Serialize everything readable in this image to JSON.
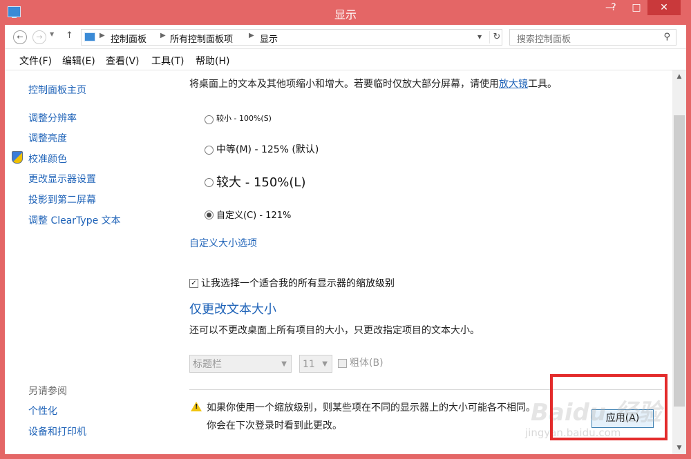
{
  "window": {
    "title": "显示"
  },
  "addressbar": {
    "breadcrumbs": [
      "控制面板",
      "所有控制面板项",
      "显示"
    ],
    "search_placeholder": "搜索控制面板"
  },
  "menubar": {
    "items": [
      "文件(F)",
      "编辑(E)",
      "查看(V)",
      "工具(T)",
      "帮助(H)"
    ]
  },
  "leftnav": {
    "home": "控制面板主页",
    "items": [
      "调整分辨率",
      "调整亮度",
      "校准颜色",
      "更改显示器设置",
      "投影到第二屏幕",
      "调整 ClearType 文本"
    ],
    "see_also_title": "另请参阅",
    "see_also": [
      "个性化",
      "设备和打印机"
    ]
  },
  "content": {
    "intro_before": "将桌面上的文本及其他项缩小和增大。若要临时仅放大部分屏幕，请使用",
    "intro_link": "放大镜",
    "intro_after": "工具。",
    "options": [
      {
        "label": "较小 - 100%(S)",
        "selected": false
      },
      {
        "label": "中等(M) - 125% (默认)",
        "selected": false
      },
      {
        "label": "较大 - 150%(L)",
        "selected": false
      },
      {
        "label": "自定义(C) - 121%",
        "selected": true
      }
    ],
    "custom_link": "自定义大小选项",
    "checkbox_label": "让我选择一个适合我的所有显示器的缩放级别",
    "checkbox_checked": true,
    "section_title": "仅更改文本大小",
    "section_desc": "还可以不更改桌面上所有项目的大小，只更改指定项目的文本大小。",
    "item_select": "标题栏",
    "size_select": "11",
    "bold_label": "粗体(B)",
    "warning_line1": "如果你使用一个缩放级别，则某些项在不同的显示器上的大小可能各不相同。",
    "warning_line2": "你会在下次登录时看到此更改。",
    "apply_button": "应用(A)"
  },
  "watermark": {
    "brand": "Baidu 经验",
    "site": "jingyan.baidu.com"
  },
  "colors": {
    "titlebar": "#e46666",
    "link": "#1f63b8",
    "highlight_box": "#e32b2b"
  }
}
